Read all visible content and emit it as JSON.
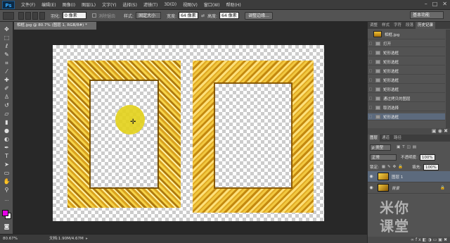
{
  "app": {
    "logo": "Ps"
  },
  "menu": [
    "文件(F)",
    "编辑(E)",
    "图像(I)",
    "图层(L)",
    "文字(Y)",
    "选择(S)",
    "滤镜(T)",
    "3D(D)",
    "视图(V)",
    "窗口(W)",
    "帮助(H)"
  ],
  "window_controls": [
    "–",
    "□",
    "✕"
  ],
  "options": {
    "feather_label": "羽化:",
    "feather_value": "0 像素",
    "antialias_label": "消除锯齿",
    "style_label": "样式:",
    "style_value": "固定大小",
    "width_label": "宽度:",
    "width_value": "64 像素",
    "height_label": "高度:",
    "height_value": "64 像素",
    "refine_edge": "调整边缘..."
  },
  "workspace_switcher": "基本功能",
  "document": {
    "tab_title": "相框.jpg @ 80.7% (图层 1, RGB/8#) *",
    "zoom": "80.67%",
    "doc_info": "文档:1.90M/4.67M"
  },
  "colors": {
    "foreground": "#e600e6",
    "background": "#ffffff",
    "selection": "#5c6a7d",
    "accent": "#31a8ff"
  },
  "history_panel": {
    "tabs": [
      "调整",
      "样式",
      "字符",
      "段落",
      "历史记录"
    ],
    "active_tab": "历史记录",
    "snapshot": "相框.jpg",
    "items": [
      "打开",
      "矩形选框",
      "矩形选框",
      "矩形选框",
      "矩形选框",
      "矩形选框",
      "通过拷贝的图层",
      "取消选择",
      "矩形选框"
    ],
    "selected_index": 8
  },
  "layers_panel": {
    "tabs": [
      "图层",
      "通道",
      "路径"
    ],
    "active_tab": "图层",
    "filter_label": "ρ 类型",
    "blend_mode": "正常",
    "opacity_label": "不透明度:",
    "opacity_value": "100%",
    "lock_label": "锁定:",
    "fill_label": "填充:",
    "fill_value": "100%",
    "layers": [
      {
        "name": "图层 1",
        "selected": true
      },
      {
        "name": "背景",
        "selected": false
      }
    ]
  },
  "watermark": {
    "line1": "米你",
    "line2": "课堂"
  }
}
